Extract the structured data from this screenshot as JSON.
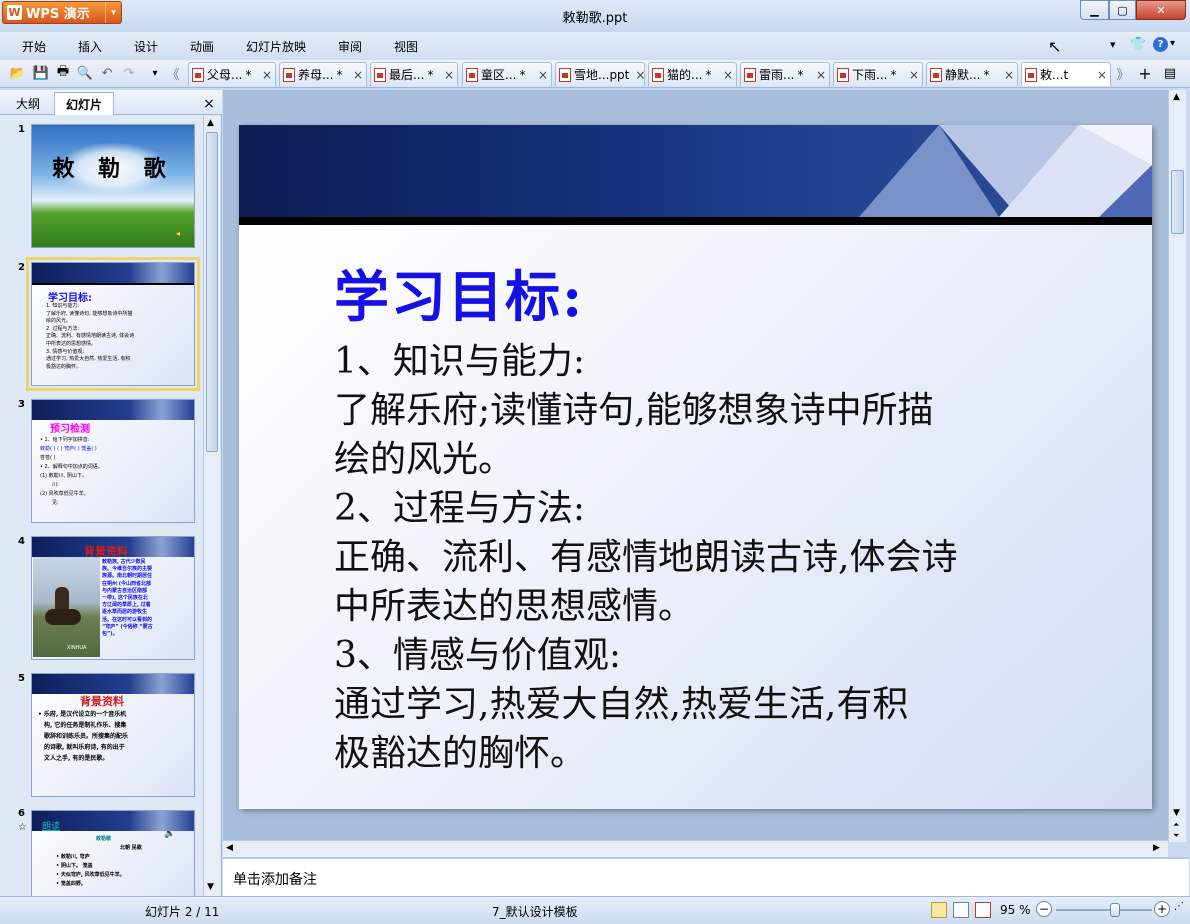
{
  "app": {
    "name": "WPS 演示",
    "window_title": "敕勒歌.ppt",
    "window_controls": [
      "minimize",
      "maximize",
      "close"
    ]
  },
  "menu": [
    "开始",
    "插入",
    "设计",
    "动画",
    "幻灯片放映",
    "审阅",
    "视图"
  ],
  "tabs": [
    {
      "label": "父母...",
      "modified": "*",
      "close": "×",
      "active": false
    },
    {
      "label": "养母...",
      "modified": "*",
      "close": "×",
      "active": false
    },
    {
      "label": "最后...",
      "modified": "*",
      "close": "×",
      "active": false
    },
    {
      "label": "童区...",
      "modified": "*",
      "close": "×",
      "active": false
    },
    {
      "label": "雪地...ppt",
      "modified": "",
      "close": "×",
      "active": false
    },
    {
      "label": "猫的...",
      "modified": "*",
      "close": "×",
      "active": false
    },
    {
      "label": "雷雨...",
      "modified": "*",
      "close": "×",
      "active": false
    },
    {
      "label": "下雨...",
      "modified": "*",
      "close": "×",
      "active": false
    },
    {
      "label": "静默...",
      "modified": "*",
      "close": "×",
      "active": false
    },
    {
      "label": "敕...t",
      "modified": "",
      "close": "×",
      "active": true
    }
  ],
  "left_pane": {
    "tabs": [
      "大纲",
      "幻灯片"
    ],
    "active_tab": "幻灯片",
    "close": "×",
    "thumbnails": [
      {
        "num": "1",
        "title": "敕 勒 歌"
      },
      {
        "num": "2",
        "title": "学习目标:",
        "lines": [
          "1. 知识与能力:",
          "了解乐府, 读懂诗句, 能够想象诗中所描",
          "绘的风光。",
          "2. 过程与方法:",
          "正确、流利、有感情地朗读古诗, 体会诗",
          "中所表达的思想感情。",
          "3. 情感与价值观:",
          "通过学习, 热爱大自然, 热爱生活, 有积",
          "极豁达的胸怀。"
        ]
      },
      {
        "num": "3",
        "title": "预习检测",
        "lines": [
          "• 1、给下列字加拼音:",
          "敕勒( )  ( )  穹庐( )  笼盖( )",
          "苍苍( )",
          "• 2、解释句中加点的词语。",
          "(1) 敕勒川, 阴山下。",
          "川:",
          "(2) 风吹草低见牛羊。",
          "见:"
        ]
      },
      {
        "num": "4",
        "title": "背景资料",
        "lines": [
          "敕勒族, 古代少数民",
          "族。今维吾尔族的主要",
          "族源。南北朝时期居住",
          "在朔州 (今山西省北部",
          "与内蒙古自治区南部",
          "一带), 这个民族在北",
          "方辽阔的草原上, 过着",
          "逐水草而居的游牧生",
          "活。在这时可以看到的",
          "“穹庐” (今俗称 “蒙古",
          "包”)。"
        ],
        "caption": "XINHUA"
      },
      {
        "num": "5",
        "title": "背景资料",
        "lines": [
          "• 乐府, 是汉代设立的一个音乐机",
          "构, 它的任务是制礼作乐、搜集",
          "歌辞和训练乐员。所搜集的配乐",
          "的诗歌, 就叫乐府诗, 有的出于",
          "文人之手, 有的是民歌。"
        ]
      },
      {
        "num": "6",
        "star": "☆",
        "title": "朗读",
        "lines": [
          "敕勒歌",
          "北朝 民歌",
          "• 敕勒川,    穹庐",
          "• 阴山下。   笼盖",
          "• 天似穹庐,  风吹草低见牛羊。",
          "• 笼盖四野。"
        ]
      }
    ]
  },
  "slide": {
    "title": "学习目标:",
    "lines": [
      "1、知识与能力:",
      "了解乐府;读懂诗句,能够想象诗中所描",
      "绘的风光。",
      "2、过程与方法:",
      "正确、流利、有感情地朗读古诗,体会诗",
      "中所表达的思想感情。",
      "3、情感与价值观:",
      "通过学习,热爱大自然,热爱生活,有积",
      "极豁达的胸怀。"
    ]
  },
  "notes": {
    "placeholder": "单击添加备注"
  },
  "status": {
    "slide_counter": "幻灯片 2 / 11",
    "template": "7_默认设计模板",
    "zoom": "95 %",
    "zoom_level": 0.95
  },
  "colors": {
    "accent": "#d9561d",
    "slide_title": "#1510e8",
    "slide_band": "#152f7a"
  }
}
